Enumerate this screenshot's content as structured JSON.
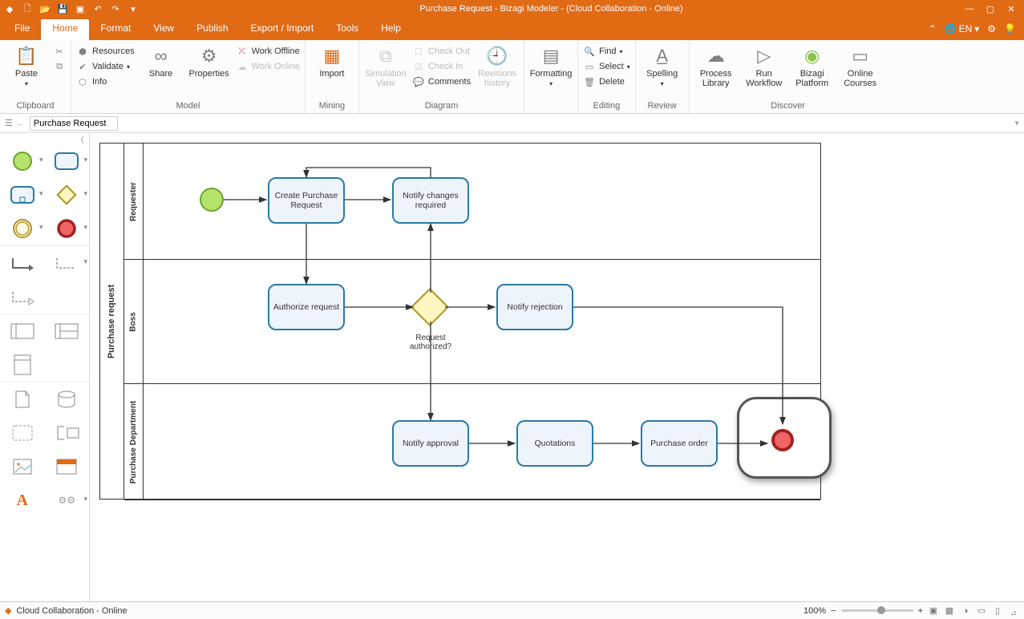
{
  "app": {
    "title": "Purchase Request - Bizagi Modeler - (Cloud Collaboration - Online)",
    "language": "EN"
  },
  "menu": {
    "file": "File",
    "tabs": [
      "Home",
      "Format",
      "View",
      "Publish",
      "Export / Import",
      "Tools",
      "Help"
    ],
    "active": "Home"
  },
  "ribbon": {
    "clipboard": {
      "label": "Clipboard",
      "paste": "Paste"
    },
    "model": {
      "label": "Model",
      "resources": "Resources",
      "validate": "Validate",
      "info": "Info",
      "share": "Share",
      "properties": "Properties",
      "work_offline": "Work Offline",
      "work_online": "Work Online"
    },
    "mining": {
      "label": "Mining",
      "import": "Import"
    },
    "diagram": {
      "label": "Diagram",
      "simview": "Simulation View",
      "checkout": "Check Out",
      "checkin": "Check In",
      "comments": "Comments",
      "revhist": "Revisions history"
    },
    "formatting": {
      "label": " ",
      "formatting": "Formatting"
    },
    "editing": {
      "label": "Editing",
      "find": "Find",
      "select": "Select",
      "delete": "Delete"
    },
    "review": {
      "label": "Review",
      "spelling": "Spelling"
    },
    "discover": {
      "label": "Discover",
      "plib": "Process Library",
      "runwf": "Run Workflow",
      "bzplatform": "Bizagi Platform",
      "courses": "Online Courses"
    }
  },
  "breadcrumb": {
    "tab": "Purchase Request"
  },
  "diagram_data": {
    "pool": "Purchase request",
    "lanes": [
      "Requester",
      "Boss",
      "Purchase Department"
    ],
    "tasks": {
      "create": "Create Purchase Request",
      "notify_changes": "Notify changes required",
      "authorize": "Authorize request",
      "notify_reject": "Notify rejection",
      "notify_approve": "Notify approval",
      "quotations": "Quotations",
      "porder": "Purchase order"
    },
    "gateway_label": "Request authorized?"
  },
  "status": {
    "text": "Cloud Collaboration - Online",
    "zoom": "100%"
  }
}
